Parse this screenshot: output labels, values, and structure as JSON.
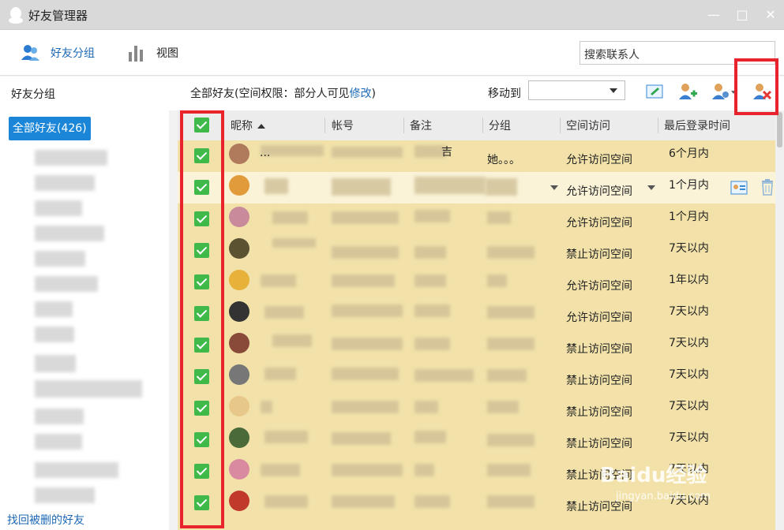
{
  "window": {
    "title": "好友管理器",
    "minimize": "—",
    "maximize": "□",
    "close": "✕"
  },
  "toolbar": {
    "tab_groups": "好友分组",
    "tab_view": "视图",
    "search_value": "搜索联系人"
  },
  "sidebar": {
    "title": "好友分组",
    "all_friends": "全部好友(426)",
    "recover_link": "找回被删的好友"
  },
  "main": {
    "permission_prefix": "全部好友(空间权限：部分人可见",
    "permission_link": "修改",
    "permission_suffix": ")",
    "move_to_label": "移动到"
  },
  "columns": [
    "昵称",
    "帐号",
    "备注",
    "分组",
    "空间访问",
    "最后登录时间"
  ],
  "rows": [
    {
      "nickname": "...",
      "remark": "吉",
      "group": "她。。。",
      "access": "允许访问空间",
      "last_login": "6个月内",
      "avatar_color": "#b07a5c"
    },
    {
      "nickname": "",
      "remark": "",
      "group": "",
      "access": "允许访问空间",
      "last_login": "1个月内",
      "avatar_color": "#e29b3a"
    },
    {
      "nickname": "",
      "remark": "",
      "group": "",
      "access": "允许访问空间",
      "last_login": "1个月内",
      "avatar_color": "#c98a9b"
    },
    {
      "nickname": "",
      "remark": "",
      "group": "",
      "access": "禁止访问空间",
      "last_login": "7天以内",
      "avatar_color": "#5a5230"
    },
    {
      "nickname": "",
      "remark": "",
      "group": "",
      "access": "允许访问空间",
      "last_login": "1年以内",
      "avatar_color": "#e8b13a"
    },
    {
      "nickname": "",
      "remark": "",
      "group": "",
      "access": "允许访问空间",
      "last_login": "7天以内",
      "avatar_color": "#333333"
    },
    {
      "nickname": "",
      "remark": "",
      "group": "",
      "access": "禁止访问空间",
      "last_login": "7天以内",
      "avatar_color": "#8a4a3a"
    },
    {
      "nickname": "",
      "remark": "",
      "group": "",
      "access": "禁止访问空间",
      "last_login": "7天以内",
      "avatar_color": "#777777"
    },
    {
      "nickname": "",
      "remark": "",
      "group": "",
      "access": "禁止访问空间",
      "last_login": "7天以内",
      "avatar_color": "#e7c88a"
    },
    {
      "nickname": "",
      "remark": "",
      "group": "",
      "access": "禁止访问空间",
      "last_login": "7天以内",
      "avatar_color": "#4a6a3a"
    },
    {
      "nickname": "",
      "remark": "",
      "group": "",
      "access": "禁止访问空间",
      "last_login": "7天以内",
      "avatar_color": "#d98aa0"
    },
    {
      "nickname": "",
      "remark": "",
      "group": "",
      "access": "禁止访问空间",
      "last_login": "7天以内",
      "avatar_color": "#c0392b"
    }
  ],
  "watermark": {
    "text": "Baidu经验",
    "sub": "jingyan.baidu.com"
  },
  "colors": {
    "accent": "#1b86d8",
    "row_bg": "#f2e2a9",
    "check_green": "#3fb94a",
    "highlight_red": "#e8232b"
  }
}
